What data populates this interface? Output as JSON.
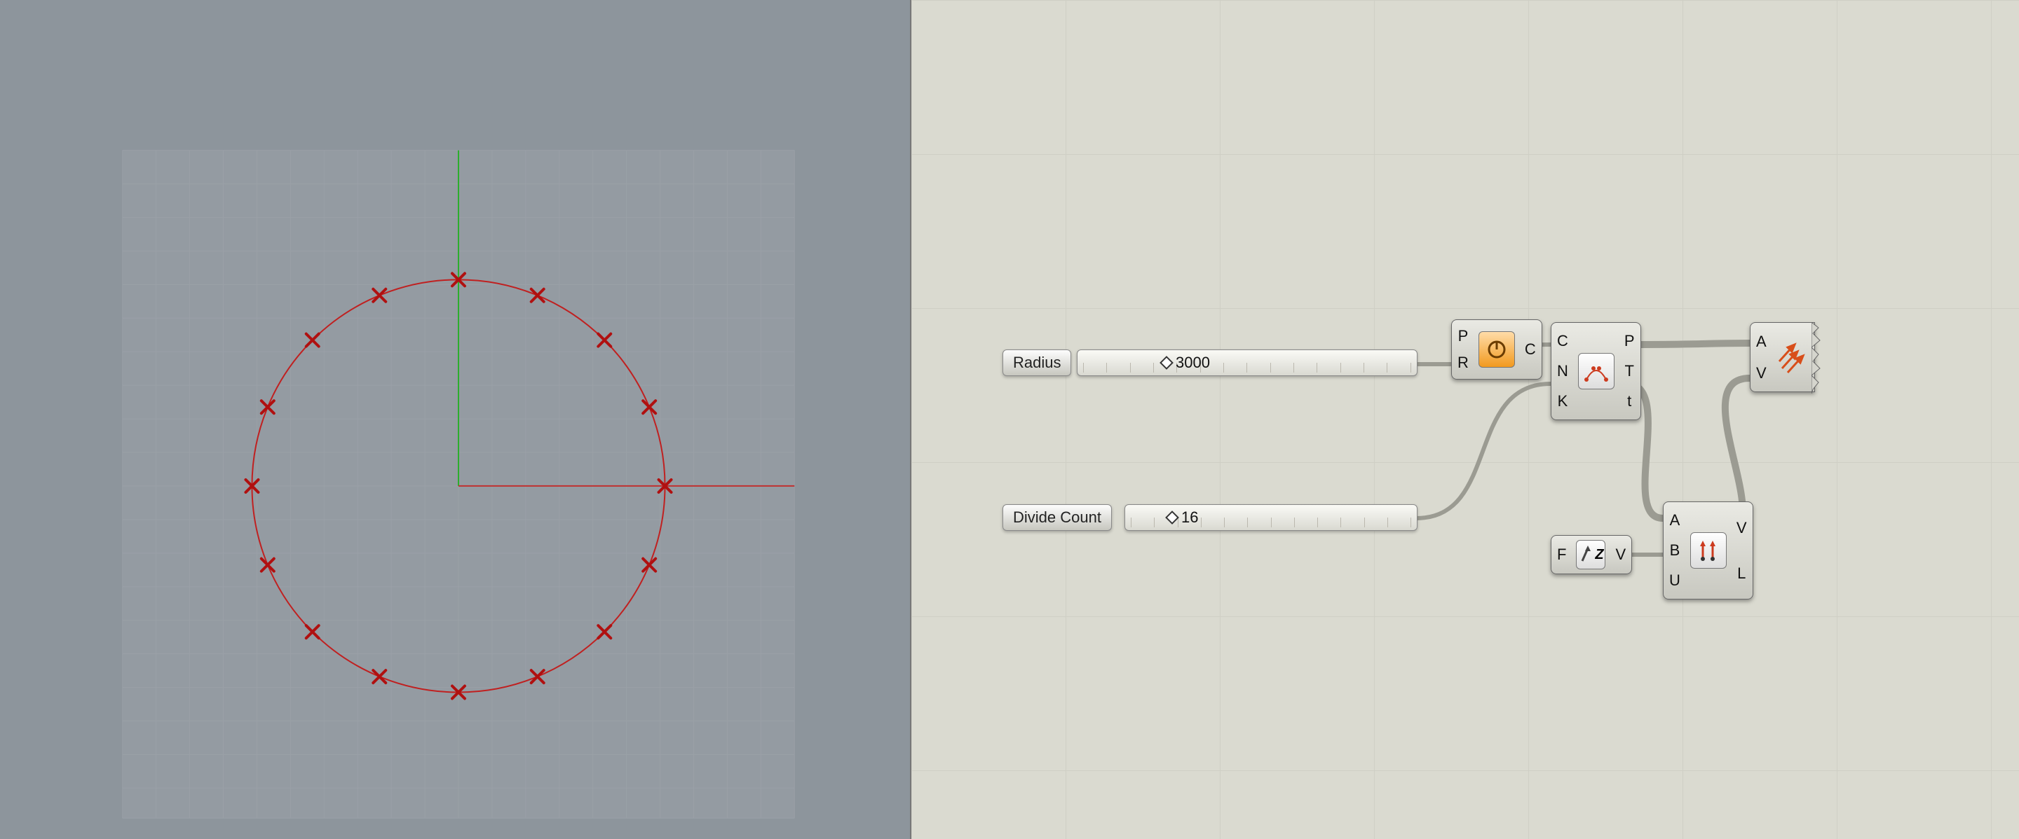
{
  "viewport": {
    "circle_radius": 3000,
    "divisions": 16,
    "axis_color_x": "#c03030",
    "axis_color_y": "#30a030",
    "marker_color": "#c02020"
  },
  "sliders": {
    "radius": {
      "label": "Radius",
      "value": "3000"
    },
    "divide": {
      "label": "Divide Count",
      "value": "16"
    }
  },
  "nodes": {
    "circle": {
      "inputs": [
        "P",
        "R"
      ],
      "outputs": [
        "C"
      ],
      "icon": "circle-icon"
    },
    "divide": {
      "inputs": [
        "C",
        "N",
        "K"
      ],
      "outputs": [
        "P",
        "T",
        "t"
      ],
      "icon": "divide-curve-icon"
    },
    "unitz": {
      "inputs": [
        "F"
      ],
      "outputs": [
        "V"
      ],
      "icon": "unit-z-icon",
      "icon_label": "Z"
    },
    "vec2pt": {
      "inputs": [
        "A",
        "B",
        "U"
      ],
      "outputs": [
        "V",
        "L"
      ],
      "icon": "vector-2pt-icon"
    },
    "vecdisp": {
      "inputs": [
        "A",
        "V"
      ],
      "outputs": [],
      "icon": "vector-display-icon"
    }
  }
}
